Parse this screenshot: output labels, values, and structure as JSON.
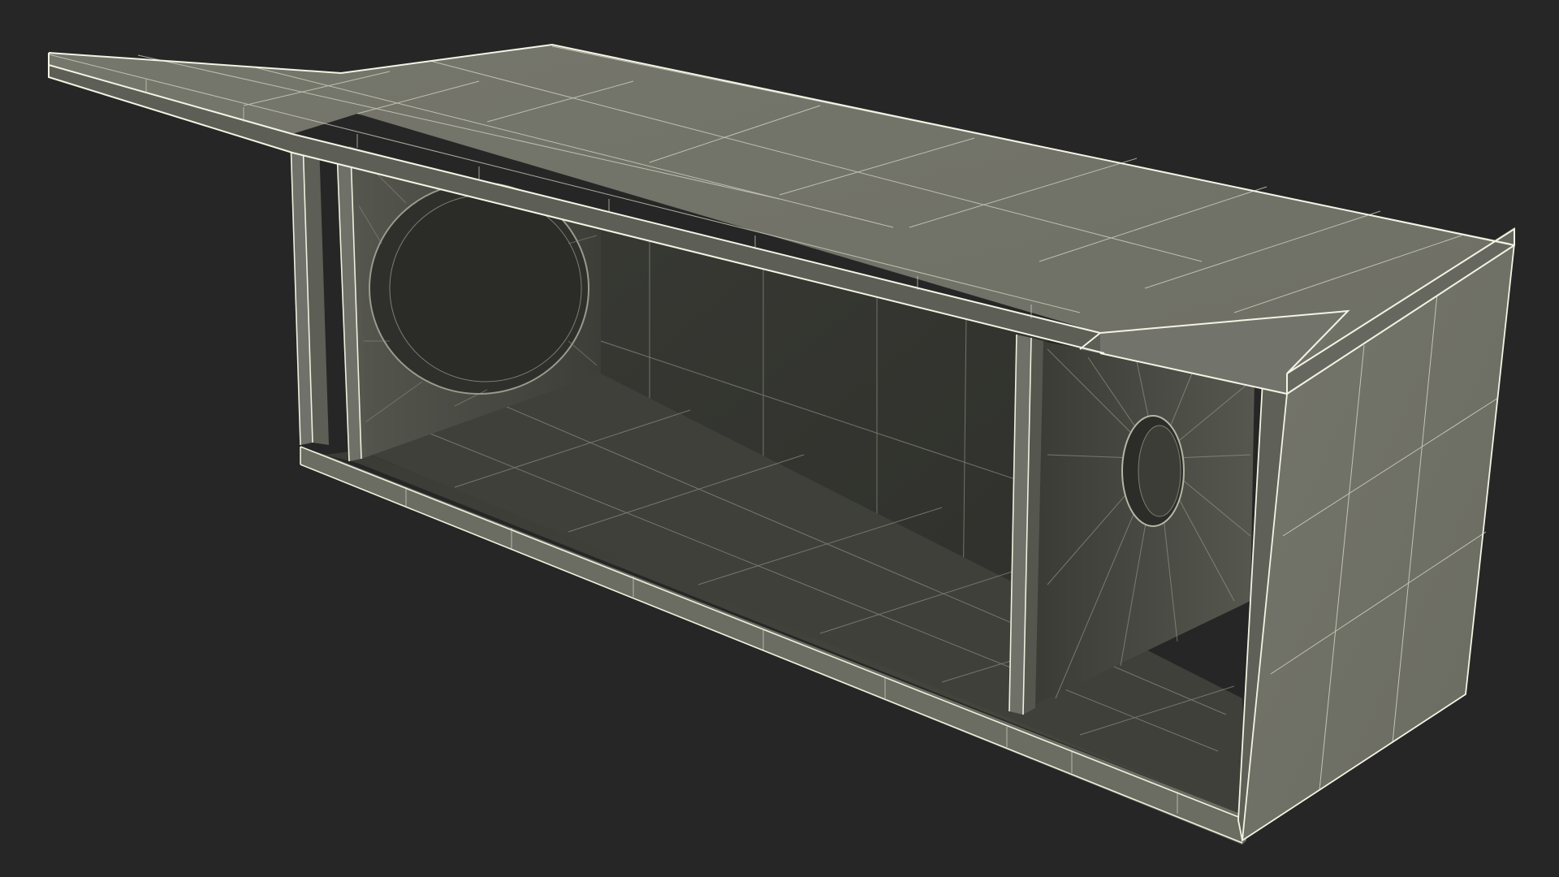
{
  "scene": {
    "subject": "wireframe-render",
    "background_color": "#262626",
    "colors": {
      "panel_light": "#7c7d72",
      "panel_mid": "#5f6058",
      "panel_dark": "#3e3f39",
      "panel_deep": "#33342f",
      "edge_highlight": "#f4f4e4",
      "wire": "#c9cab8"
    }
  }
}
